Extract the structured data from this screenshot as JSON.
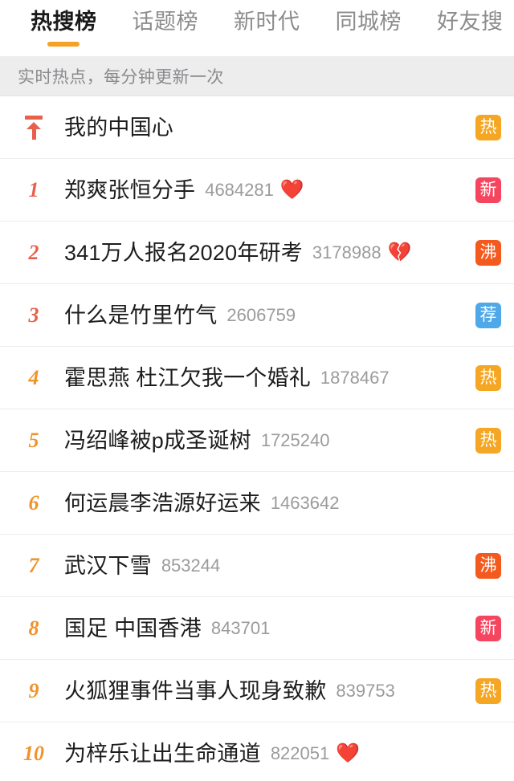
{
  "tabs": [
    {
      "label": "热搜榜",
      "active": true
    },
    {
      "label": "话题榜",
      "active": false
    },
    {
      "label": "新时代",
      "active": false
    },
    {
      "label": "同城榜",
      "active": false
    },
    {
      "label": "好友搜",
      "active": false
    }
  ],
  "subtitle": "实时热点，每分钟更新一次",
  "colors": {
    "accent": "#f7a026",
    "rank_top3": "#e8604c",
    "rank_rest": "#f0932b",
    "badge_hot": "#f5a623",
    "badge_new": "#f5455f",
    "badge_boil": "#f4591d",
    "badge_rec": "#4fa8e8",
    "title_text": "#1d1d1d",
    "hotnum_text": "#9b9b9b",
    "subtitle_bg": "#ededee"
  },
  "rows": [
    {
      "rank": "",
      "rank_icon": "pin-to-top-icon",
      "title": "我的中国心",
      "hot": "",
      "emoji": "",
      "badge": "热",
      "badge_type": "hot"
    },
    {
      "rank": "1",
      "rank_icon": "",
      "title": "郑爽张恒分手",
      "hot": "4684281",
      "emoji": "❤️",
      "badge": "新",
      "badge_type": "new"
    },
    {
      "rank": "2",
      "rank_icon": "",
      "title": "341万人报名2020年研考",
      "hot": "3178988",
      "emoji": "💔",
      "badge": "沸",
      "badge_type": "boil"
    },
    {
      "rank": "3",
      "rank_icon": "",
      "title": "什么是竹里竹气",
      "hot": "2606759",
      "emoji": "",
      "badge": "荐",
      "badge_type": "rec"
    },
    {
      "rank": "4",
      "rank_icon": "",
      "title": "霍思燕 杜江欠我一个婚礼",
      "hot": "1878467",
      "emoji": "",
      "badge": "热",
      "badge_type": "hot"
    },
    {
      "rank": "5",
      "rank_icon": "",
      "title": "冯绍峰被p成圣诞树",
      "hot": "1725240",
      "emoji": "",
      "badge": "热",
      "badge_type": "hot"
    },
    {
      "rank": "6",
      "rank_icon": "",
      "title": "何运晨李浩源好运来",
      "hot": "1463642",
      "emoji": "",
      "badge": "",
      "badge_type": "none"
    },
    {
      "rank": "7",
      "rank_icon": "",
      "title": "武汉下雪",
      "hot": "853244",
      "emoji": "",
      "badge": "沸",
      "badge_type": "boil"
    },
    {
      "rank": "8",
      "rank_icon": "",
      "title": "国足 中国香港",
      "hot": "843701",
      "emoji": "",
      "badge": "新",
      "badge_type": "new"
    },
    {
      "rank": "9",
      "rank_icon": "",
      "title": "火狐狸事件当事人现身致歉",
      "hot": "839753",
      "emoji": "",
      "badge": "热",
      "badge_type": "hot"
    },
    {
      "rank": "10",
      "rank_icon": "",
      "title": "为梓乐让出生命通道",
      "hot": "822051",
      "emoji": "❤️",
      "badge": "",
      "badge_type": "none"
    }
  ]
}
